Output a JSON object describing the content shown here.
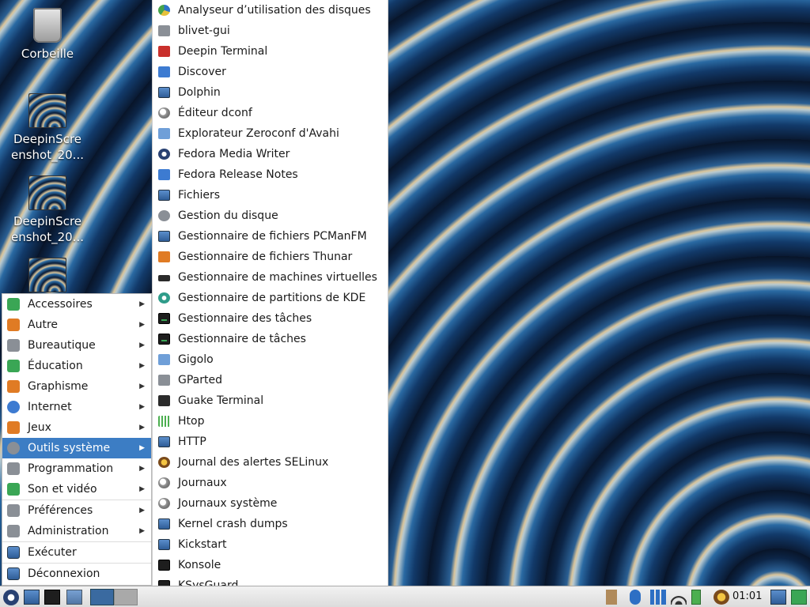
{
  "desktop": {
    "icons": [
      {
        "label": "Corbeille",
        "icon": "trash-icon"
      },
      {
        "label_line1": "DeepinScre",
        "label_line2": "enshot_20...",
        "icon": "image-file-icon"
      },
      {
        "label_line1": "DeepinScre",
        "label_line2": "enshot_20...",
        "icon": "image-file-icon"
      }
    ]
  },
  "menu": {
    "categories": [
      {
        "label": "Accessoires",
        "icon": "accessories-icon"
      },
      {
        "label": "Autre",
        "icon": "other-icon"
      },
      {
        "label": "Bureautique",
        "icon": "office-icon"
      },
      {
        "label": "Éducation",
        "icon": "education-icon"
      },
      {
        "label": "Graphisme",
        "icon": "graphics-icon"
      },
      {
        "label": "Internet",
        "icon": "internet-icon"
      },
      {
        "label": "Jeux",
        "icon": "games-icon"
      },
      {
        "label": "Outils système",
        "icon": "system-tools-icon",
        "active": true
      },
      {
        "label": "Programmation",
        "icon": "programming-icon"
      },
      {
        "label": "Son et vidéo",
        "icon": "multimedia-icon"
      },
      {
        "label": "Préférences",
        "icon": "preferences-icon"
      },
      {
        "label": "Administration",
        "icon": "administration-icon"
      },
      {
        "label": "Exécuter",
        "icon": "run-icon"
      },
      {
        "label": "Déconnexion",
        "icon": "logout-icon"
      }
    ],
    "submenu": [
      {
        "label": "Analyseur d’utilisation des disques",
        "icon": "disk-usage-icon"
      },
      {
        "label": "blivet-gui",
        "icon": "blivet-icon"
      },
      {
        "label": "Deepin Terminal",
        "icon": "deepin-terminal-icon"
      },
      {
        "label": "Discover",
        "icon": "discover-icon"
      },
      {
        "label": "Dolphin",
        "icon": "dolphin-icon"
      },
      {
        "label": "Éditeur dconf",
        "icon": "dconf-editor-icon"
      },
      {
        "label": "Explorateur Zeroconf d'Avahi",
        "icon": "avahi-icon"
      },
      {
        "label": "Fedora Media Writer",
        "icon": "media-writer-icon"
      },
      {
        "label": "Fedora Release Notes",
        "icon": "release-notes-icon"
      },
      {
        "label": "Fichiers",
        "icon": "files-icon"
      },
      {
        "label": "Gestion du disque",
        "icon": "disk-management-icon"
      },
      {
        "label": "Gestionnaire de fichiers PCManFM",
        "icon": "pcmanfm-icon"
      },
      {
        "label": "Gestionnaire de fichiers Thunar",
        "icon": "thunar-icon"
      },
      {
        "label": "Gestionnaire de machines virtuelles",
        "icon": "virt-manager-icon"
      },
      {
        "label": "Gestionnaire de partitions de KDE",
        "icon": "kde-partition-icon"
      },
      {
        "label": "Gestionnaire des tâches",
        "icon": "task-manager-icon"
      },
      {
        "label": "Gestionnaire de tâches",
        "icon": "task-manager-icon"
      },
      {
        "label": "Gigolo",
        "icon": "gigolo-icon"
      },
      {
        "label": "GParted",
        "icon": "gparted-icon"
      },
      {
        "label": "Guake Terminal",
        "icon": "guake-icon"
      },
      {
        "label": "Htop",
        "icon": "htop-icon"
      },
      {
        "label": "HTTP",
        "icon": "http-icon"
      },
      {
        "label": "Journal des alertes SELinux",
        "icon": "selinux-icon"
      },
      {
        "label": "Journaux",
        "icon": "logs-icon"
      },
      {
        "label": "Journaux système",
        "icon": "system-logs-icon"
      },
      {
        "label": "Kernel crash dumps",
        "icon": "kdump-icon"
      },
      {
        "label": "Kickstart",
        "icon": "kickstart-icon"
      },
      {
        "label": "Konsole",
        "icon": "konsole-icon"
      },
      {
        "label": "KSysGuard",
        "icon": "ksysguard-icon"
      }
    ],
    "scroll_indicator": "▼"
  },
  "taskbar": {
    "clock": "01:01"
  }
}
